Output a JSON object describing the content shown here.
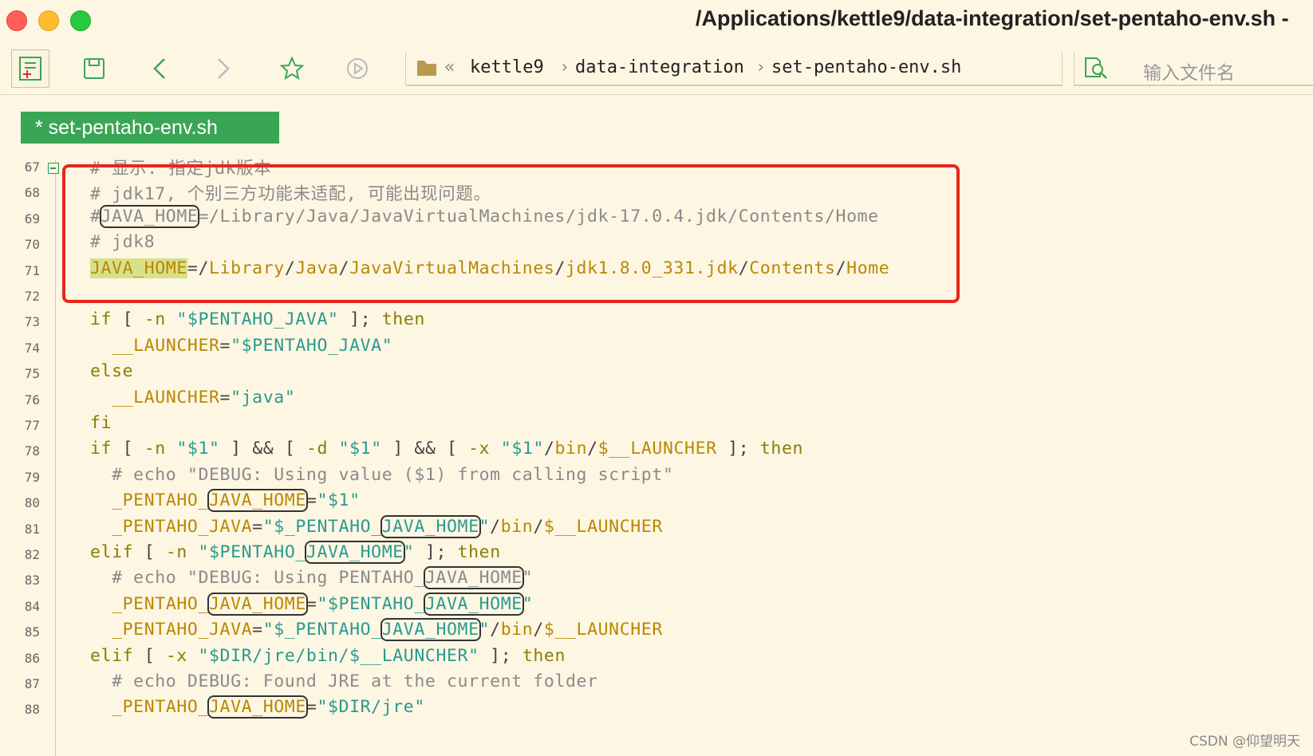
{
  "window": {
    "title": "/Applications/kettle9/data-integration/set-pentaho-env.sh -"
  },
  "toolbar": {
    "breadcrumb": {
      "overflow": "«",
      "items": [
        "kettle9",
        "data-integration",
        "set-pentaho-env.sh"
      ]
    },
    "search_placeholder": "输入文件名"
  },
  "tab": {
    "label": "* set-pentaho-env.sh"
  },
  "editor": {
    "lines": [
      {
        "num": "67",
        "text": "# 显示: 指定jdk版本"
      },
      {
        "num": "68",
        "text": "# jdk17, 个别三方功能未适配, 可能出现问题。"
      },
      {
        "num": "69",
        "text": "#JAVA_HOME=/Library/Java/JavaVirtualMachines/jdk-17.0.4.jdk/Contents/Home"
      },
      {
        "num": "70",
        "text": "# jdk8"
      },
      {
        "num": "71",
        "text": "JAVA_HOME=/Library/Java/JavaVirtualMachines/jdk1.8.0_331.jdk/Contents/Home"
      },
      {
        "num": "72",
        "text": ""
      },
      {
        "num": "73",
        "text": "if [ -n \"$PENTAHO_JAVA\" ]; then"
      },
      {
        "num": "74",
        "text": "  __LAUNCHER=\"$PENTAHO_JAVA\""
      },
      {
        "num": "75",
        "text": "else"
      },
      {
        "num": "76",
        "text": "  __LAUNCHER=\"java\""
      },
      {
        "num": "77",
        "text": "fi"
      },
      {
        "num": "78",
        "text": "if [ -n \"$1\" ] && [ -d \"$1\" ] && [ -x \"$1\"/bin/$__LAUNCHER ]; then"
      },
      {
        "num": "79",
        "text": "  # echo \"DEBUG: Using value ($1) from calling script\""
      },
      {
        "num": "80",
        "text": "  _PENTAHO_JAVA_HOME=\"$1\""
      },
      {
        "num": "81",
        "text": "  _PENTAHO_JAVA=\"$_PENTAHO_JAVA_HOME\"/bin/$__LAUNCHER"
      },
      {
        "num": "82",
        "text": "elif [ -n \"$PENTAHO_JAVA_HOME\" ]; then"
      },
      {
        "num": "83",
        "text": "  # echo \"DEBUG: Using PENTAHO_JAVA_HOME\""
      },
      {
        "num": "84",
        "text": "  _PENTAHO_JAVA_HOME=\"$PENTAHO_JAVA_HOME\""
      },
      {
        "num": "85",
        "text": "  _PENTAHO_JAVA=\"$_PENTAHO_JAVA_HOME\"/bin/$__LAUNCHER"
      },
      {
        "num": "86",
        "text": "elif [ -x \"$DIR/jre/bin/$__LAUNCHER\" ]; then"
      },
      {
        "num": "87",
        "text": "  # echo DEBUG: Found JRE at the current folder"
      },
      {
        "num": "88",
        "text": "  _PENTAHO_JAVA_HOME=\"$DIR/jre\""
      }
    ]
  },
  "watermark": "CSDN @仰望明天",
  "colors": {
    "background": "#fdf6e3",
    "tab_active": "#3aa655",
    "annotation_box": "#e8261c",
    "keyword": "#8a7d00",
    "string": "#2a9a8f",
    "variable": "#b88800",
    "comment": "#8a8a8a"
  },
  "icons": [
    "new-file-icon",
    "save-icon",
    "back-icon",
    "forward-icon",
    "star-icon",
    "play-icon",
    "folder-icon",
    "file-search-icon"
  ]
}
